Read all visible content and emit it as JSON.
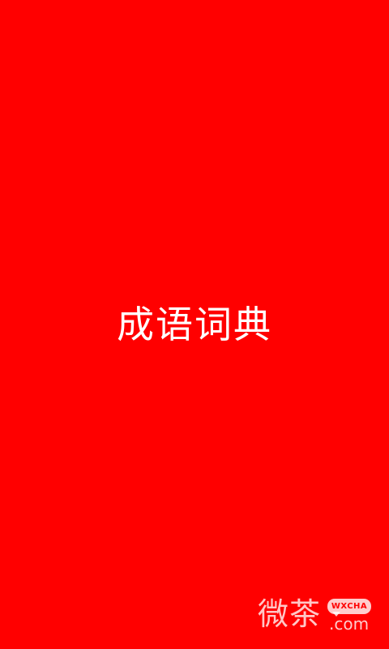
{
  "app": {
    "title": "成语词典"
  },
  "watermark": {
    "chars": "微茶",
    "badge": "WXCHA",
    "domain": ".com"
  },
  "colors": {
    "background": "#ff0000",
    "text": "#ffffff"
  }
}
